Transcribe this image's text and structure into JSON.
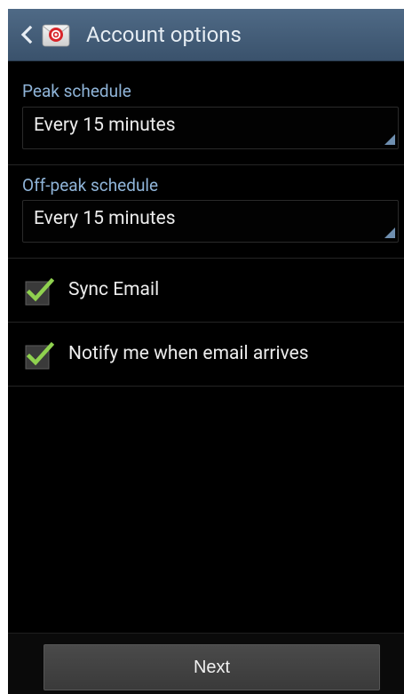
{
  "header": {
    "title": "Account options",
    "back_icon": "chevron-left-icon",
    "app_icon": "email-app-icon"
  },
  "peak": {
    "label": "Peak schedule",
    "value": "Every 15 minutes"
  },
  "offpeak": {
    "label": "Off-peak schedule",
    "value": "Every 15 minutes"
  },
  "options": [
    {
      "label": "Sync Email",
      "checked": true
    },
    {
      "label": "Notify me when email arrives",
      "checked": true
    }
  ],
  "footer": {
    "next_label": "Next"
  },
  "colors": {
    "action_bar": "#4a6480",
    "section_label": "#8fb4d8",
    "check_green": "#8fd14f",
    "background": "#000000"
  }
}
